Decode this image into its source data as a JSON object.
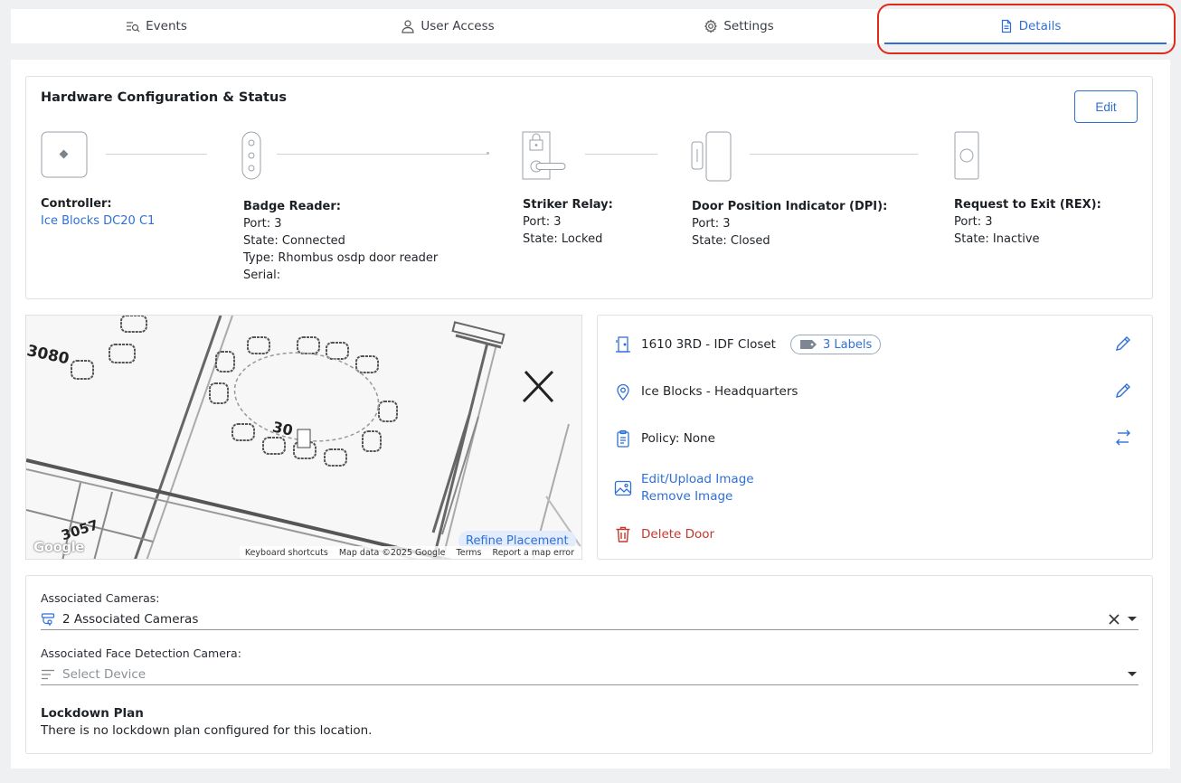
{
  "tabs": [
    {
      "label": "Events",
      "icon": "events-search-icon"
    },
    {
      "label": "User Access",
      "icon": "user-icon"
    },
    {
      "label": "Settings",
      "icon": "gear-icon"
    },
    {
      "label": "Details",
      "icon": "document-icon",
      "active": true
    }
  ],
  "hardware": {
    "title": "Hardware Configuration & Status",
    "edit_label": "Edit",
    "controller": {
      "label": "Controller:",
      "value": "Ice Blocks DC20 C1"
    },
    "badge_reader": {
      "label": "Badge Reader:",
      "port": "Port: 3",
      "state": "State: Connected",
      "type": "Type: Rhombus osdp door reader",
      "serial": "Serial:"
    },
    "striker_relay": {
      "label": "Striker Relay:",
      "port": "Port: 3",
      "state": "State: Locked"
    },
    "dpi": {
      "label": "Door Position Indicator (DPI):",
      "port": "Port: 3",
      "state": "State: Closed"
    },
    "rex": {
      "label": "Request to Exit (REX):",
      "port": "Port: 3",
      "state": "State: Inactive"
    }
  },
  "map": {
    "refine_label": "Refine Placement",
    "logo": "Google",
    "footer": [
      "Keyboard shortcuts",
      "Map data ©2025 Google",
      "Terms",
      "Report a map error"
    ],
    "room_labels": [
      "3080",
      "3057"
    ]
  },
  "door": {
    "name": "1610 3RD - IDF Closet",
    "labels_badge": "3 Labels",
    "location": "Ice Blocks - Headquarters",
    "policy": "Policy: None",
    "edit_image": "Edit/Upload Image",
    "remove_image": "Remove Image",
    "delete": "Delete Door"
  },
  "associations": {
    "cameras_label": "Associated Cameras:",
    "cameras_value": "2 Associated Cameras",
    "face_label": "Associated Face Detection Camera:",
    "face_placeholder": "Select Device",
    "lockdown_title": "Lockdown Plan",
    "lockdown_text": "There is no lockdown plan configured for this location."
  },
  "colors": {
    "accent": "#2f6fd6",
    "danger": "#c8372c",
    "highlight": "#e02a1a"
  }
}
